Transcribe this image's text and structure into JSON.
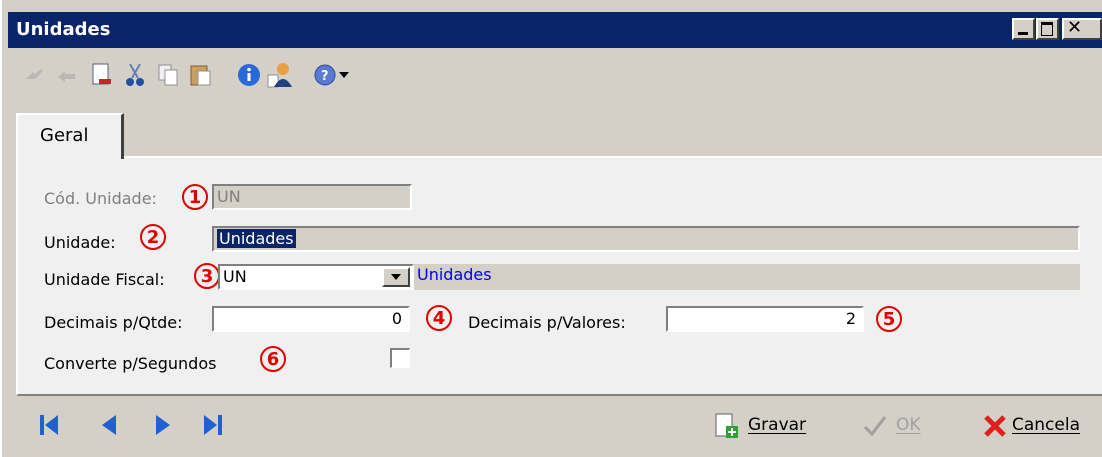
{
  "window": {
    "title": "Unidades"
  },
  "toolbar": {
    "icons": [
      "first-record-icon",
      "previous-record-icon",
      "new-document-icon",
      "cut-icon",
      "copy-icon",
      "paste-icon",
      "info-icon",
      "user-icon",
      "help-icon",
      "dropdown-arrow-icon"
    ]
  },
  "tabs": [
    {
      "label": "Geral"
    }
  ],
  "form": {
    "cod_unidade": {
      "label": "Cód. Unidade:",
      "value": "UN",
      "badge": "1"
    },
    "unidade": {
      "label": "Unidade:",
      "value": "Unidades",
      "badge": "2"
    },
    "unidade_fiscal": {
      "label": "Unidade Fiscal:",
      "value": "UN",
      "description": "Unidades",
      "badge": "3"
    },
    "decimais_qtde": {
      "label": "Decimais p/Qtde:",
      "value": "0",
      "badge": "4"
    },
    "decimais_valores": {
      "label": "Decimais p/Valores:",
      "value": "2",
      "badge": "5"
    },
    "converte_segundos": {
      "label": "Converte p/Segundos",
      "checked": false,
      "badge": "6"
    }
  },
  "footer": {
    "gravar_label": "Gravar",
    "ok_label": "OK",
    "cancela_label": "Cancela"
  },
  "colors": {
    "titlebar": "#0a246a",
    "accent_badge": "#e00000",
    "selection": "#0a246a",
    "link_blue": "#0000ff"
  }
}
